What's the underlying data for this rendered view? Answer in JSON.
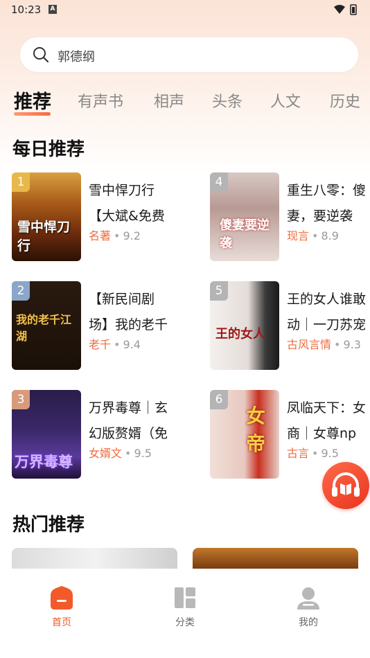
{
  "status_bar": {
    "time": "10:23",
    "notification_letter": "A"
  },
  "search": {
    "query": "郭德纲"
  },
  "tabs": [
    {
      "label": "推荐",
      "active": true
    },
    {
      "label": "有声书"
    },
    {
      "label": "相声"
    },
    {
      "label": "头条"
    },
    {
      "label": "人文"
    },
    {
      "label": "历史"
    }
  ],
  "daily": {
    "title": "每日推荐",
    "books": [
      {
        "rank": "1",
        "title_line1": "雪中悍刀行",
        "title_line2": "【大斌&免费",
        "tag": "名著",
        "score": "9.2",
        "cover_text": "雪中悍刀行",
        "rank_color": "#e8b84a"
      },
      {
        "rank": "2",
        "title_line1": "【新民间剧",
        "title_line2": "场】我的老千",
        "tag": "老千",
        "score": "9.4",
        "cover_text": "我的老千江湖",
        "rank_color": "#8aa6c9"
      },
      {
        "rank": "3",
        "title_line1": "万界毒尊｜玄",
        "title_line2": "幻版赘婿（免",
        "tag": "女婿文",
        "score": "9.5",
        "cover_text": "万界毒尊",
        "rank_color": "#d79a7a"
      },
      {
        "rank": "4",
        "title_line1": "重生八零：傻",
        "title_line2": "妻，要逆袭",
        "tag": "现言",
        "score": "8.9",
        "cover_text": "傻妻要逆袭",
        "rank_color": "#b4b4b4"
      },
      {
        "rank": "5",
        "title_line1": "王的女人谁敢",
        "title_line2": "动｜一刀苏宠",
        "tag": "古风言情",
        "score": "9.3",
        "cover_text": "王的女人",
        "rank_color": "#b4b4b4"
      },
      {
        "rank": "6",
        "title_line1": "凤临天下：女",
        "title_line2": "商｜女尊np",
        "tag": "古言",
        "score": "9.5",
        "cover_text": "女帝",
        "rank_color": "#b4b4b4"
      }
    ]
  },
  "hot": {
    "title": "热门推荐"
  },
  "bottom_nav": [
    {
      "label": "首页",
      "icon": "home-icon",
      "active": true
    },
    {
      "label": "分类",
      "icon": "category-icon"
    },
    {
      "label": "我的",
      "icon": "profile-icon"
    }
  ],
  "colors": {
    "accent": "#f25a2a",
    "tag": "#f06a3c"
  }
}
